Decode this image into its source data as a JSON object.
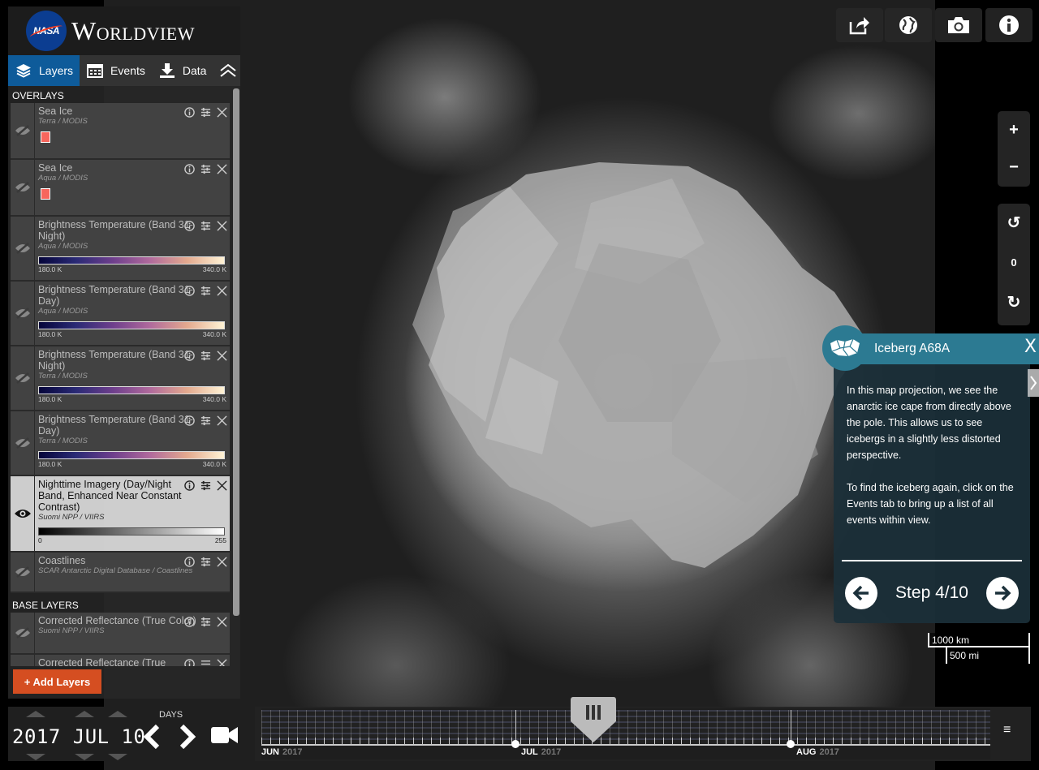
{
  "app": {
    "title": "Worldview",
    "agency": "NASA"
  },
  "tabs": [
    {
      "label": "Layers",
      "icon": "layers-icon",
      "active": true
    },
    {
      "label": "Events",
      "icon": "calendar-icon",
      "active": false
    },
    {
      "label": "Data",
      "icon": "download-icon",
      "active": false
    }
  ],
  "groups": {
    "overlays": "OVERLAYS",
    "base": "BASE LAYERS"
  },
  "overlays": [
    {
      "name": "Sea Ice",
      "sub": "Terra / MODIS",
      "legend": "swatch",
      "visible": false
    },
    {
      "name": "Sea Ice",
      "sub": "Aqua / MODIS",
      "legend": "swatch",
      "visible": false
    },
    {
      "name": "Brightness Temperature (Band 31-Night)",
      "sub": "Aqua / MODIS",
      "legend": "bar",
      "min": "180.0 K",
      "max": "340.0 K",
      "visible": false
    },
    {
      "name": "Brightness Temperature (Band 31-Day)",
      "sub": "Aqua / MODIS",
      "legend": "bar",
      "min": "180.0 K",
      "max": "340.0 K",
      "visible": false
    },
    {
      "name": "Brightness Temperature (Band 31-Night)",
      "sub": "Terra / MODIS",
      "legend": "bar",
      "min": "180.0 K",
      "max": "340.0 K",
      "visible": false
    },
    {
      "name": "Brightness Temperature (Band 31-Day)",
      "sub": "Terra / MODIS",
      "legend": "bar",
      "min": "180.0 K",
      "max": "340.0 K",
      "visible": false
    },
    {
      "name": "Nighttime Imagery (Day/Night Band, Enhanced Near Constant Contrast)",
      "sub": "Suomi NPP / VIIRS",
      "legend": "gray",
      "min": "0",
      "max": "255",
      "visible": true
    },
    {
      "name": "Coastlines",
      "sub": "SCAR Antarctic Digital Database / Coastlines",
      "legend": "none",
      "visible": false
    }
  ],
  "base_layers": [
    {
      "name": "Corrected Reflectance (True Color)",
      "sub": "Suomi NPP / VIIRS",
      "visible": false
    },
    {
      "name": "Corrected Reflectance (True",
      "sub": "",
      "visible": false
    }
  ],
  "add_layers_label": "+ Add Layers",
  "toolbar": [
    "share-icon",
    "projection-globe-icon",
    "camera-icon",
    "info-icon"
  ],
  "zoom": {
    "in": "+",
    "out": "−"
  },
  "rotate": {
    "left": "↺",
    "value": "0",
    "right": "↻"
  },
  "tour": {
    "title": "Iceberg A68A",
    "close": "X",
    "paragraphs": [
      "In this map projection, we see the anarctic ice cape from directly above the pole. This allows us to see icebergs in a slightly less distorted perspective.",
      "To find the iceberg again, click on the Events tab to bring up a list of all events within view."
    ],
    "step": "Step 4/10"
  },
  "scale": {
    "km": "1000 km",
    "mi": "500 mi"
  },
  "timeline": {
    "date": "2017 JUL 10",
    "interval": "DAYS",
    "months": [
      {
        "label": "JUN",
        "year": "2017"
      },
      {
        "label": "JUL",
        "year": "2017"
      },
      {
        "label": "AUG",
        "year": "2017"
      }
    ]
  },
  "colors": {
    "accent": "#0e5b9a",
    "add_button": "#d54e21",
    "tour": "#2c7a92",
    "swatch": "#f7665d"
  }
}
